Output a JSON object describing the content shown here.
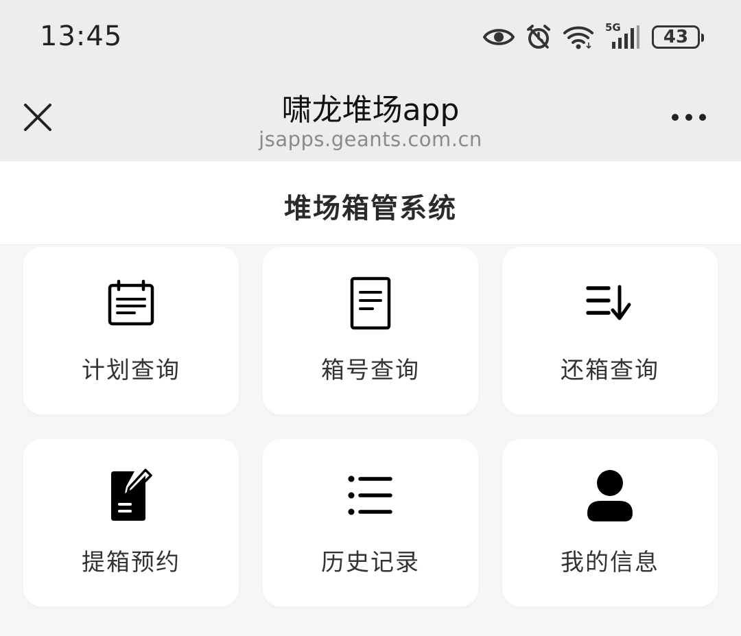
{
  "status": {
    "time": "13:45",
    "network": "5G",
    "battery": "43"
  },
  "nav": {
    "title": "啸龙堆场app",
    "url": "jsapps.geants.com.cn"
  },
  "page": {
    "title": "堆场箱管系统"
  },
  "menu": [
    {
      "label": "计划查询",
      "icon": "calendar-icon"
    },
    {
      "label": "箱号查询",
      "icon": "document-icon"
    },
    {
      "label": "还箱查询",
      "icon": "sort-down-icon"
    },
    {
      "label": "提箱预约",
      "icon": "edit-note-icon"
    },
    {
      "label": "历史记录",
      "icon": "list-icon"
    },
    {
      "label": "我的信息",
      "icon": "user-icon"
    }
  ]
}
